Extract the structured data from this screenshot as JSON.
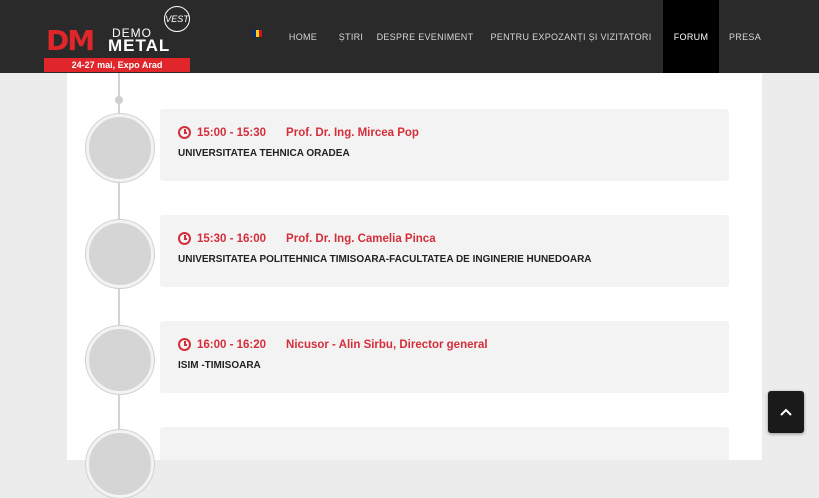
{
  "header": {
    "logo": {
      "mark": "DM",
      "demo": "DEMO",
      "metal": "METAL",
      "vest": "VEST",
      "banner": "24-27 mai, Expo Arad"
    },
    "flag_colors": [
      "#002b7f",
      "#fcd116",
      "#ce1126"
    ],
    "nav": [
      {
        "label": "HOME",
        "active": false
      },
      {
        "label": "ȘTIRI",
        "active": false
      },
      {
        "label": "DESPRE EVENIMENT",
        "active": false
      },
      {
        "label": "PENTRU EXPOZANȚI ȘI VIZITATORI",
        "active": false
      },
      {
        "label": "FORUM",
        "active": true
      },
      {
        "label": "PRESA",
        "active": false
      }
    ]
  },
  "schedule": [
    {
      "time": "15:00 - 15:30",
      "speaker": "Prof. Dr. Ing. Mircea Pop",
      "institution": "UNIVERSITATEA TEHNICA ORADEA"
    },
    {
      "time": "15:30 - 16:00",
      "speaker": "Prof. Dr. Ing. Camelia Pinca",
      "institution": "UNIVERSITATEA POLITEHNICA TIMISOARA-FACULTATEA DE INGINERIE HUNEDOARA"
    },
    {
      "time": "16:00 - 16:20",
      "speaker": "Nicusor - Alin Sirbu, Director general",
      "institution": "ISIM -TIMISOARA"
    },
    {
      "time": "",
      "speaker": "",
      "institution": ""
    }
  ],
  "scroll_top_icon": "chevron-up-icon",
  "accent_color": "#d42e3a"
}
